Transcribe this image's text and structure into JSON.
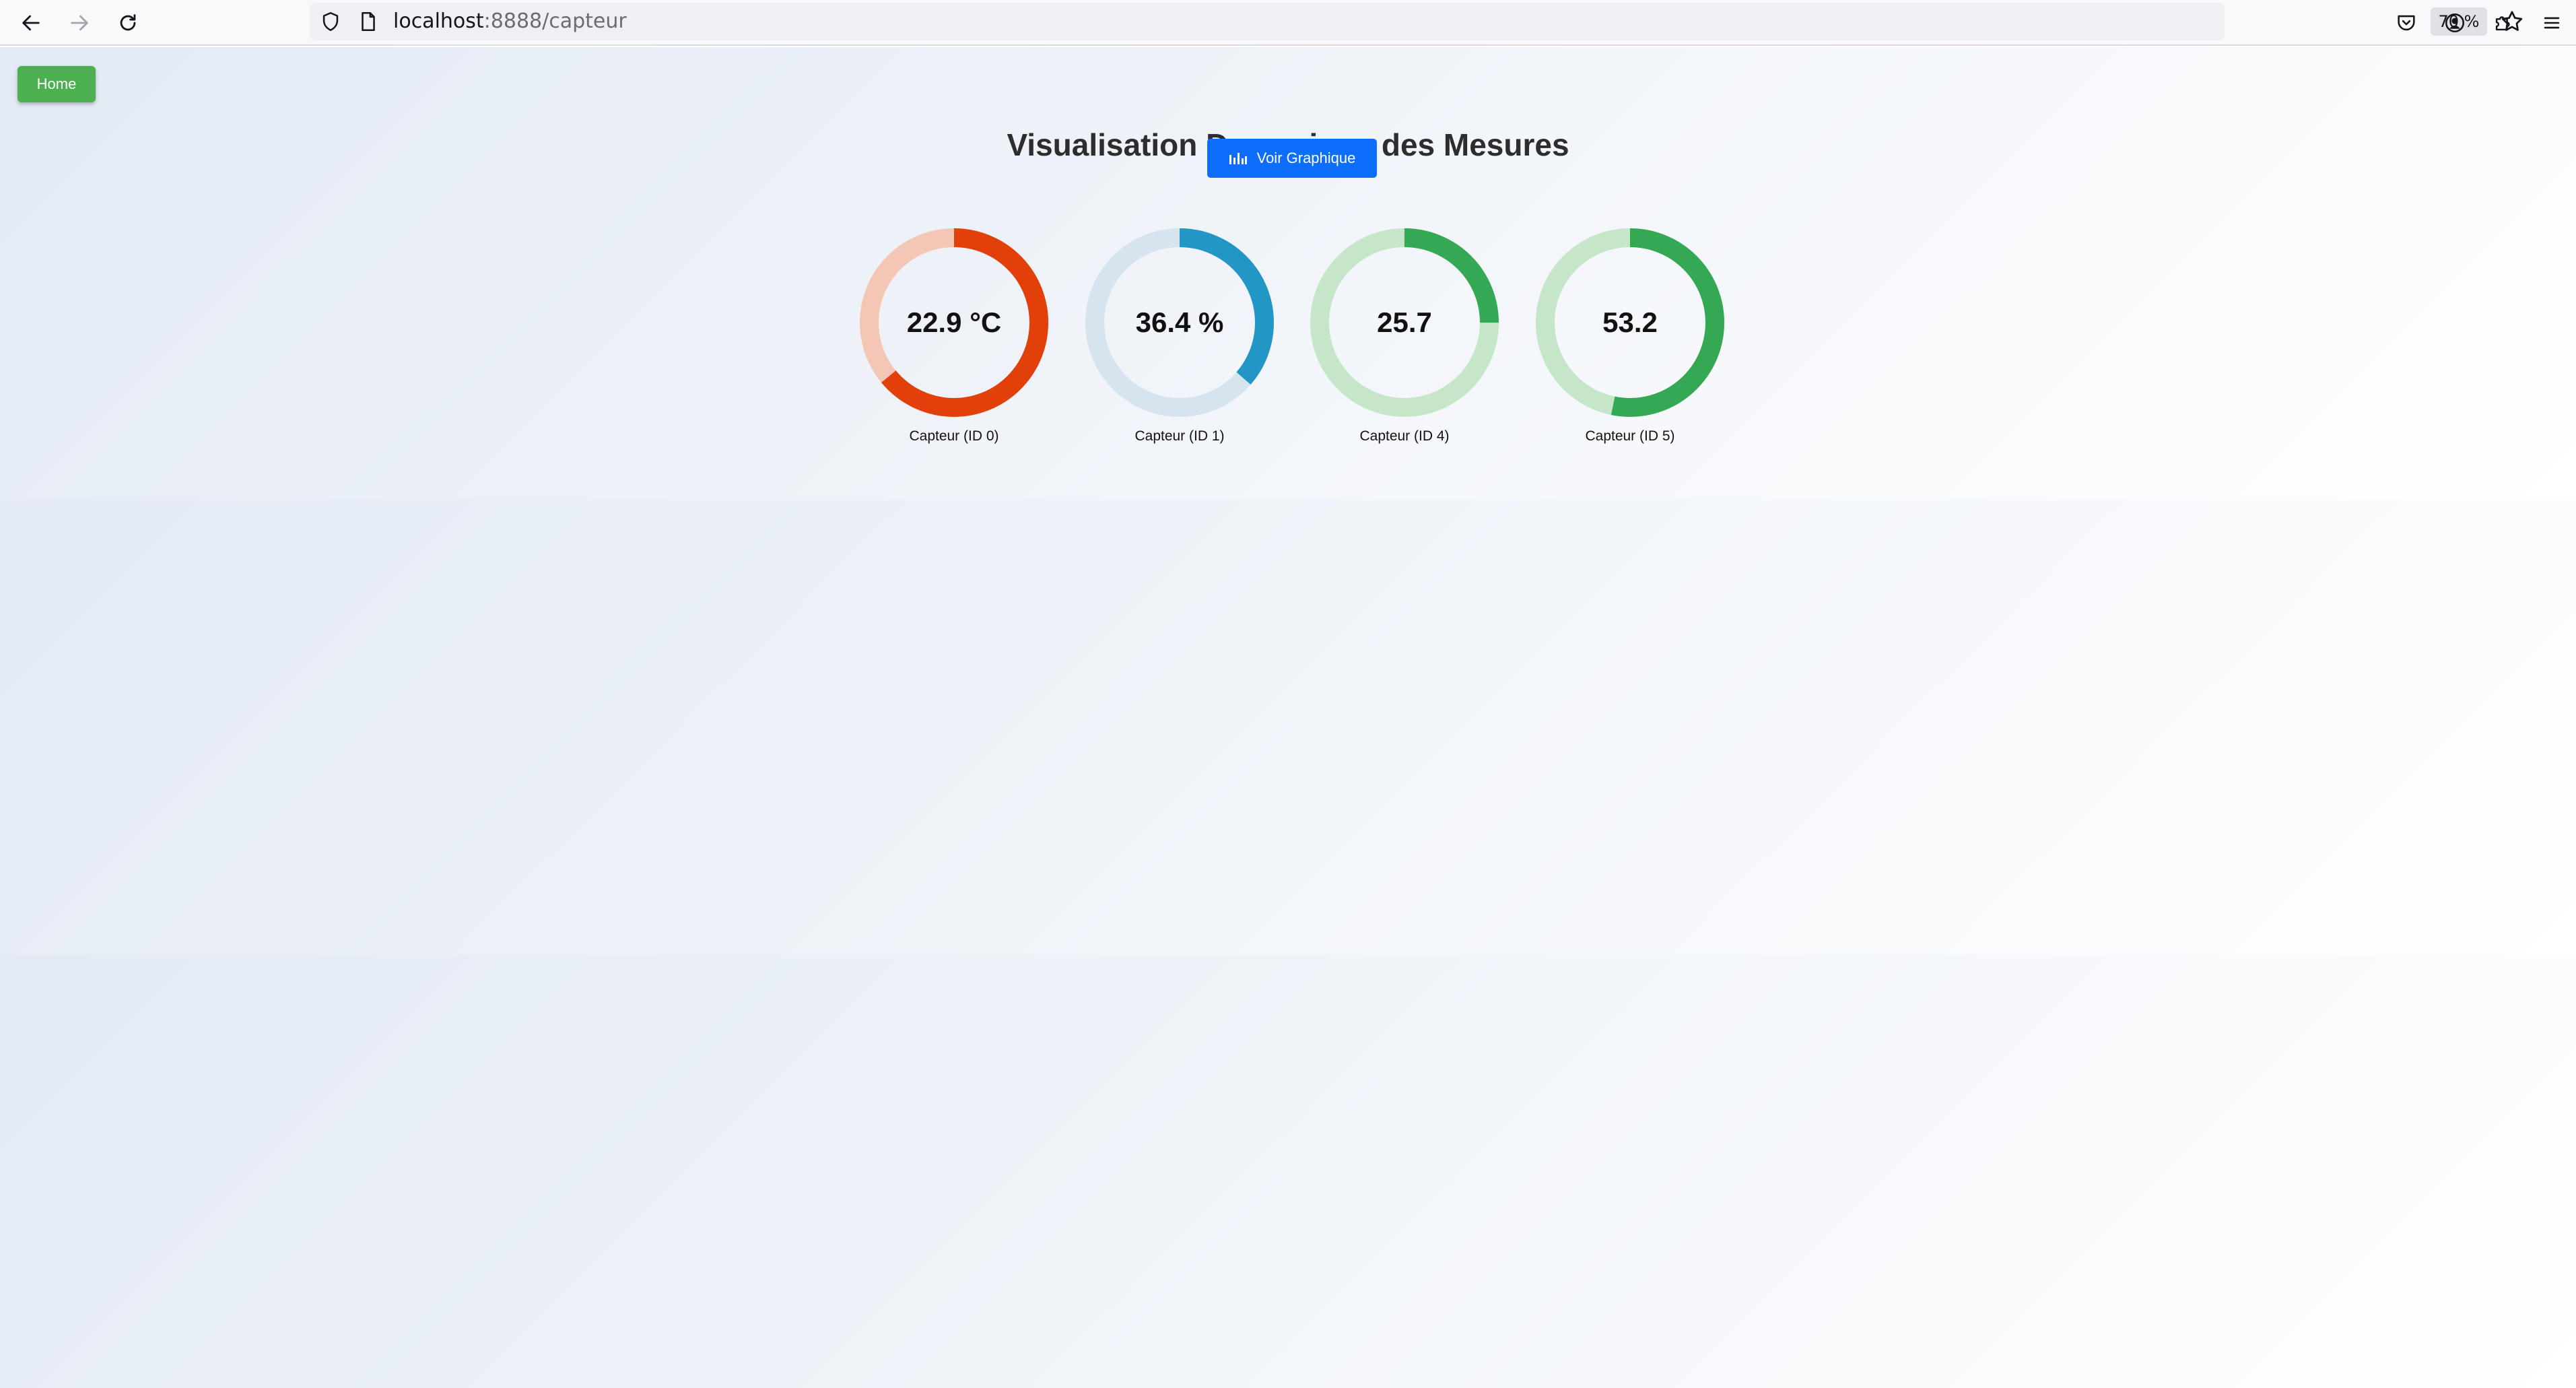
{
  "browser": {
    "url_host": "localhost",
    "url_path": ":8888/capteur",
    "zoom": "70 %"
  },
  "page": {
    "home_label": "Home",
    "title": "Visualisation Dynamique des Mesures",
    "graph_button_label": "Voir Graphique"
  },
  "sensors": [
    {
      "display": "22.9 °C",
      "label": "Capteur (ID 0)",
      "fraction": 0.64,
      "color": "#e2400b",
      "track": "#f4c6b6"
    },
    {
      "display": "36.4 %",
      "label": "Capteur (ID 1)",
      "fraction": 0.364,
      "color": "#2296c4",
      "track": "#d6e4ef"
    },
    {
      "display": "25.7",
      "label": "Capteur (ID 4)",
      "fraction": 0.25,
      "color": "#34a853",
      "track": "#c5e6c9"
    },
    {
      "display": "53.2",
      "label": "Capteur (ID 5)",
      "fraction": 0.532,
      "color": "#34a853",
      "track": "#c5e6c9"
    }
  ],
  "icons": {
    "back": "arrow-left-icon",
    "forward": "arrow-right-icon",
    "reload": "reload-icon",
    "shield": "shield-icon",
    "page": "page-icon",
    "bookmark": "star-icon",
    "pocket": "pocket-icon",
    "account": "account-icon",
    "extensions": "puzzle-icon",
    "menu": "hamburger-menu-icon",
    "chart": "bar-chart-icon"
  }
}
